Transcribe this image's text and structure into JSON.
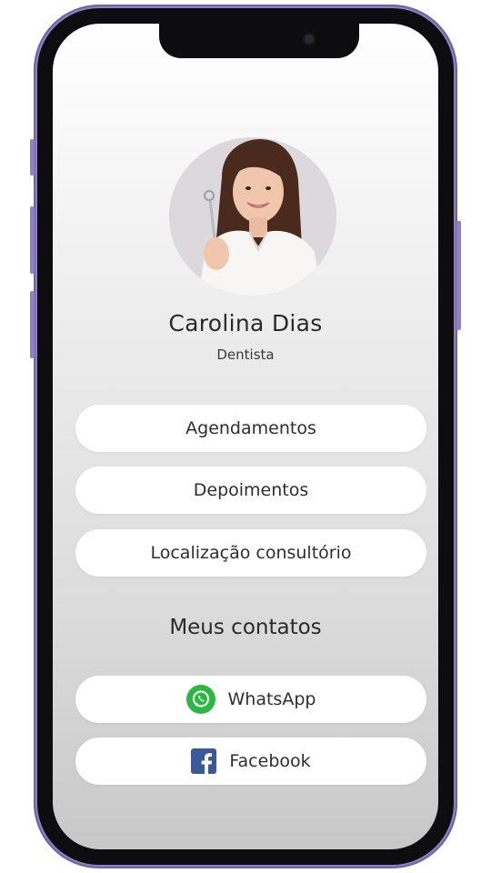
{
  "profile": {
    "name": "Carolina Dias",
    "role": "Dentista"
  },
  "links": [
    {
      "label": "Agendamentos"
    },
    {
      "label": "Depoimentos"
    },
    {
      "label": "Localização consultório"
    }
  ],
  "contacts": {
    "title": "Meus contatos",
    "items": [
      {
        "label": "WhatsApp",
        "icon": "whatsapp-icon",
        "color": "#2bb741"
      },
      {
        "label": "Facebook",
        "icon": "facebook-icon",
        "color": "#3b5998"
      }
    ]
  },
  "colors": {
    "frame": "#8e82c4",
    "button_bg": "#ffffff"
  }
}
